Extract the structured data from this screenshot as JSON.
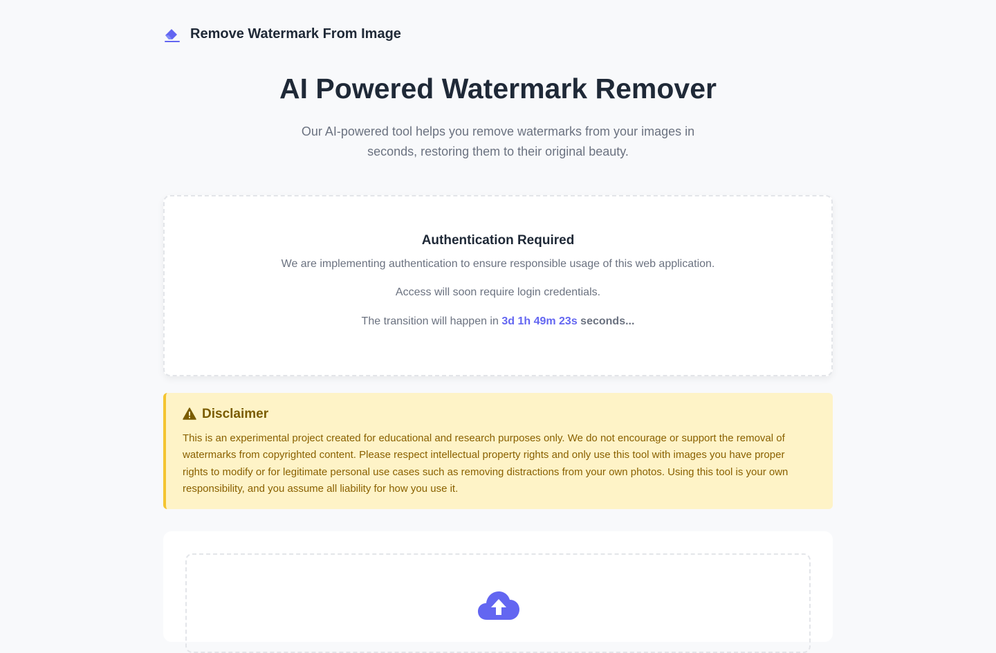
{
  "header": {
    "brand_icon": "eraser-icon",
    "title": "Remove Watermark From Image"
  },
  "hero": {
    "title": "AI Powered Watermark Remover",
    "subtitle": "Our AI-powered tool helps you remove watermarks from your images in seconds, restoring them to their original beauty."
  },
  "auth": {
    "title": " Authentication Required",
    "line1": "We are implementing authentication to ensure responsible usage of this web application.",
    "line2": "Access will soon require login credentials.",
    "line3_prefix": "The transition will happen in ",
    "countdown": "3d 1h 49m 23s",
    "line3_suffix": " seconds..."
  },
  "disclaimer": {
    "icon": "warning-icon",
    "title": "Disclaimer",
    "text": "This is an experimental project created for educational and research purposes only. We do not encourage or support the removal of watermarks from copyrighted content. Please respect intellectual property rights and only use this tool with images you have proper rights to modify or for legitimate personal use cases such as removing distractions from your own photos. Using this tool is your own responsibility, and you assume all liability for how you use it."
  },
  "upload": {
    "icon": "cloud-upload-icon"
  },
  "colors": {
    "accent": "#6366f1",
    "background": "#f8f9fb",
    "warning_bg": "#fef3c7",
    "warning_border": "#f4c430",
    "warning_text": "#8a6100"
  }
}
